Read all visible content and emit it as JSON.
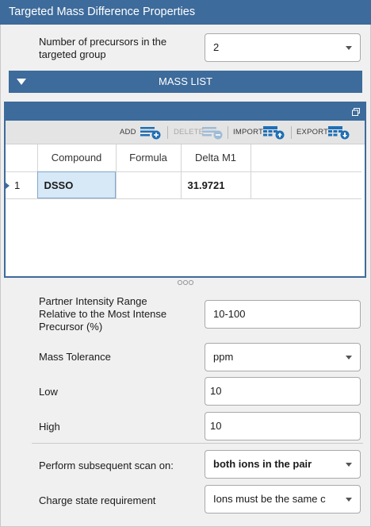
{
  "title": "Targeted Mass Difference Properties",
  "precursors": {
    "label": "Number of precursors in the targeted group",
    "label_line1": "Number of precursors in the",
    "label_line2": "targeted group",
    "value": "2"
  },
  "mass_list": {
    "header": "MASS LIST",
    "toolbar": {
      "add": "ADD",
      "delete": "DELETE",
      "import": "IMPORT",
      "export": "EXPORT"
    },
    "columns": [
      "Compound",
      "Formula",
      "Delta M1"
    ],
    "rows": [
      {
        "index": "1",
        "compound": "DSSO",
        "formula": "",
        "delta_m1": "31.9721"
      }
    ]
  },
  "partner_intensity": {
    "label_line1": "Partner Intensity Range",
    "label_line2": "Relative to the Most Intense",
    "label_line3": "Precursor (%)",
    "value": "10-100"
  },
  "mass_tolerance": {
    "label": "Mass Tolerance",
    "value": "ppm"
  },
  "low": {
    "label": "Low",
    "value": "10"
  },
  "high": {
    "label": "High",
    "value": "10"
  },
  "subsequent_scan": {
    "label": "Perform subsequent scan on:",
    "value": "both ions in the pair"
  },
  "charge_state": {
    "label": "Charge state requirement",
    "value": "Ions must be the same c"
  },
  "colors": {
    "accent": "#3d6b9b",
    "icon_blue": "#1f6fb5",
    "selection": "#d7e8f6"
  }
}
